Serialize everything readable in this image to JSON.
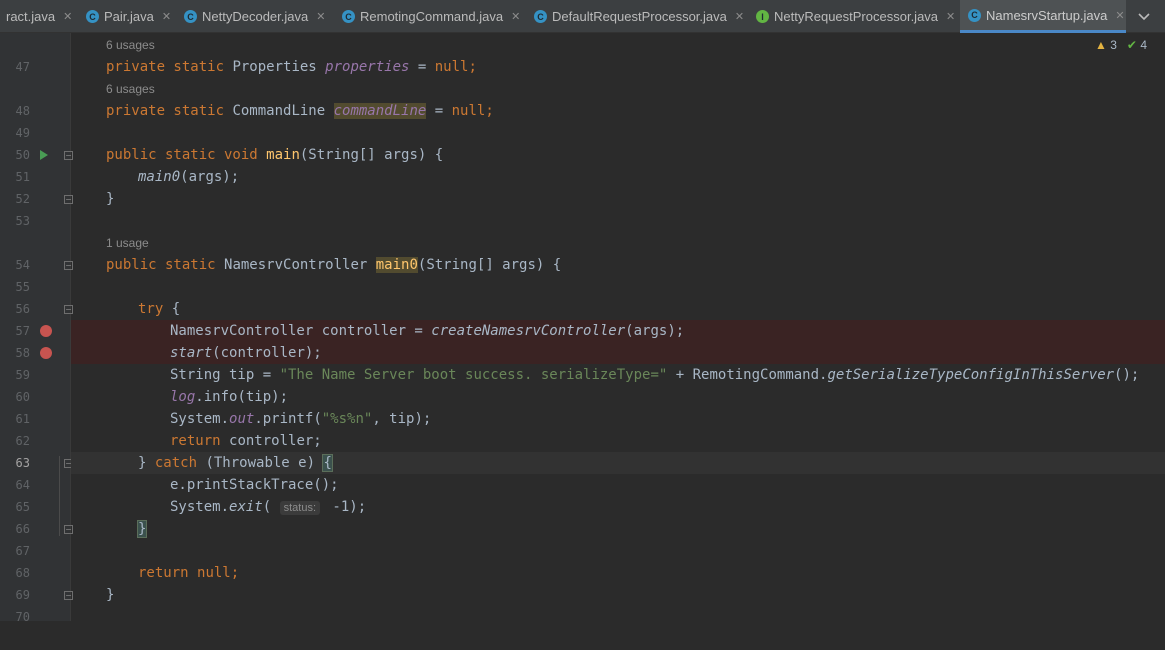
{
  "tabs": [
    {
      "label": "ract.java",
      "icon": "none",
      "active": false
    },
    {
      "label": "Pair.java",
      "icon": "C",
      "active": false
    },
    {
      "label": "NettyDecoder.java",
      "icon": "C",
      "active": false
    },
    {
      "label": "RemotingCommand.java",
      "icon": "C",
      "active": false
    },
    {
      "label": "DefaultRequestProcessor.java",
      "icon": "C",
      "active": false
    },
    {
      "label": "NettyRequestProcessor.java",
      "icon": "I",
      "active": false
    },
    {
      "label": "NamesrvStartup.java",
      "icon": "C",
      "active": true
    }
  ],
  "inspections": {
    "warnings": "3",
    "checks": "4"
  },
  "hints": {
    "usages_properties": "6 usages",
    "usages_commandLine": "6 usages",
    "usages_main0": "1 usage"
  },
  "line_numbers": [
    "47",
    "48",
    "49",
    "50",
    "51",
    "52",
    "53",
    "54",
    "55",
    "56",
    "57",
    "58",
    "59",
    "60",
    "61",
    "62",
    "63",
    "64",
    "65",
    "66",
    "67",
    "68",
    "69",
    "70"
  ],
  "code": {
    "l47": {
      "a": "private static ",
      "b": "Properties ",
      "c": "properties",
      "d": " = ",
      "e": "null",
      ";": ";"
    },
    "l48": {
      "a": "private static ",
      "b": "CommandLine ",
      "c": "commandLine",
      "d": " = ",
      "e": "null",
      ";": ";"
    },
    "l50": {
      "a": "public static void ",
      "b": "main",
      "c": "(String[] args) {"
    },
    "l51": {
      "a": "main0",
      "b": "(args);"
    },
    "l52": {
      "a": "}"
    },
    "l54": {
      "a": "public static ",
      "b": "NamesrvController ",
      "c": "main0",
      "d": "(String[] args) {"
    },
    "l56": {
      "a": "try ",
      "b": "{"
    },
    "l57": {
      "a": "NamesrvController controller = ",
      "b": "createNamesrvController",
      "c": "(args);"
    },
    "l58": {
      "a": "start",
      "b": "(controller);"
    },
    "l59": {
      "a": "String tip = ",
      "b": "\"The Name Server boot success. serializeType=\"",
      "c": " + RemotingCommand.",
      "d": "getSerializeTypeConfigInThisServer",
      "e": "();"
    },
    "l60": {
      "a": "log",
      "b": ".info(tip);"
    },
    "l61": {
      "a": "System.",
      "b": "out",
      "c": ".printf(",
      "d": "\"%s%n\"",
      "e": ", tip);"
    },
    "l62": {
      "a": "return ",
      "b": "controller;"
    },
    "l63": {
      "a": "} ",
      "b": "catch ",
      "c": "(Throwable e) ",
      "d": "{"
    },
    "l64": {
      "a": "e.printStackTrace();"
    },
    "l65": {
      "a": "System.",
      "b": "exit",
      "c": "( ",
      "d": "status:",
      "e": " -1);"
    },
    "l66": {
      "a": "}"
    },
    "l68": {
      "a": "return ",
      "b": "null;"
    },
    "l69": {
      "a": "}"
    }
  }
}
